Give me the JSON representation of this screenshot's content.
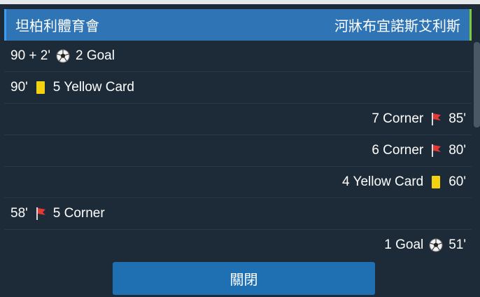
{
  "header": {
    "home_team": "坦柏利體育會",
    "away_team": "河牀布宜諾斯艾利斯"
  },
  "events": [
    {
      "side": "home",
      "minute": "90 + 2'",
      "icon": "soccer-ball-icon",
      "text": "2 Goal"
    },
    {
      "side": "home",
      "minute": "90'",
      "icon": "yellow-card-icon",
      "text": "5 Yellow Card"
    },
    {
      "side": "away",
      "minute": "85'",
      "icon": "corner-flag-icon",
      "text": "7 Corner"
    },
    {
      "side": "away",
      "minute": "80'",
      "icon": "corner-flag-icon",
      "text": "6 Corner"
    },
    {
      "side": "away",
      "minute": "60'",
      "icon": "yellow-card-icon",
      "text": "4 Yellow Card"
    },
    {
      "side": "home",
      "minute": "58'",
      "icon": "corner-flag-icon",
      "text": "5 Corner"
    },
    {
      "side": "away",
      "minute": "51'",
      "icon": "soccer-ball-icon",
      "text": "1 Goal"
    }
  ],
  "colors": {
    "header_bg": "#2f74b5",
    "panel_bg": "#1d2a38",
    "yellow_card": "#f3d20f",
    "button_bg": "#1f6fb3"
  },
  "close_button": {
    "label": "關閉"
  }
}
